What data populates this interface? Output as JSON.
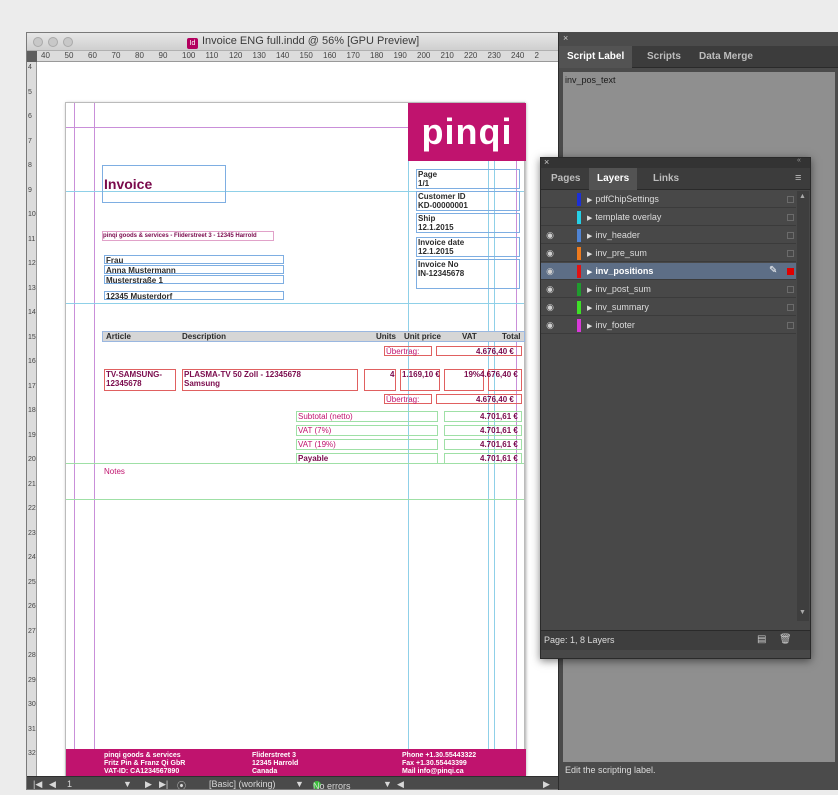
{
  "window": {
    "title": "Invoice ENG full.indd @ 56% [GPU Preview]"
  },
  "ruler": {
    "h_marks": [
      "40",
      "50",
      "60",
      "70",
      "80",
      "90",
      "100",
      "110",
      "120",
      "130",
      "140",
      "150",
      "160",
      "170",
      "180",
      "190",
      "200",
      "210",
      "220",
      "230",
      "240",
      "2"
    ],
    "v_marks": [
      "4",
      "5",
      "6",
      "7",
      "8",
      "9",
      "10",
      "11",
      "12",
      "13",
      "14",
      "15",
      "16",
      "17",
      "18",
      "19",
      "20",
      "21",
      "22",
      "23",
      "24",
      "25",
      "26",
      "27",
      "28",
      "29",
      "30",
      "31",
      "32"
    ]
  },
  "invoice": {
    "logo": "pinqi",
    "title": "Invoice",
    "sender_line": "pinqi goods & services - Fliderstreet 3 - 12345 Harrold",
    "recipient": [
      "Frau",
      "Anna Mustermann",
      "Musterstraße 1",
      "12345 Musterdorf"
    ],
    "meta": {
      "page_label": "Page",
      "page_value": "1/1",
      "customer_label": "Customer ID",
      "customer_value": "KD-00000001",
      "ship_label": "Ship",
      "ship_value": "12.1.2015",
      "date_label": "Invoice date",
      "date_value": "12.1.2015",
      "no_label": "Invoice No",
      "no_value": "IN-12345678"
    },
    "table_headers": {
      "article": "Article",
      "description": "Description",
      "units": "Units",
      "unit_price": "Unit price",
      "vat": "VAT",
      "total": "Total"
    },
    "carry_label": "Übertrag:",
    "carry_value": "4.676,40 €",
    "row": {
      "article": "TV-SAMSUNG-12345678",
      "description_1": "PLASMA-TV 50 Zoll - 12345678",
      "description_2": "Samsung",
      "units": "4",
      "unit_price": "1.169,10 €",
      "vat": "19%",
      "total": "4.676,40 €"
    },
    "carry2_label": "Übertrag:",
    "carry2_value": "4.676,40 €",
    "summary": [
      {
        "label": "Subtotal (netto)",
        "value": "4.701,61 €"
      },
      {
        "label": "VAT (7%)",
        "value": "4.701,61 €"
      },
      {
        "label": "VAT (19%)",
        "value": "4.701,61 €"
      },
      {
        "label": "Payable",
        "value": "4.701,61 €"
      }
    ],
    "notes": "Notes",
    "footer": {
      "c1": [
        "pinqi goods & services",
        "Fritz Pin & Franz Qi GbR",
        "VAT-ID: CA1234567890"
      ],
      "c2": [
        "Fliderstreet 3",
        "12345 Harrold",
        "Canada"
      ],
      "c3": [
        "Phone +1.30.55443322",
        "Fax +1.30.55443399",
        "Mail info@pinqi.ca"
      ]
    }
  },
  "statusbar": {
    "page": "1",
    "style": "[Basic] (working)",
    "errors": "No errors"
  },
  "script_panel": {
    "tabs": [
      "Script Label",
      "Scripts",
      "Data Merge"
    ],
    "label_text": "inv_pos_text",
    "hint": "Edit the scripting label."
  },
  "layers_panel": {
    "tabs": [
      "Pages",
      "Layers",
      "Links"
    ],
    "layers": [
      {
        "name": "pdfChipSettings",
        "color": "#1c2fd6",
        "visible": false
      },
      {
        "name": "template overlay",
        "color": "#25d0e6",
        "visible": false
      },
      {
        "name": "inv_header",
        "color": "#4f84d4",
        "visible": true
      },
      {
        "name": "inv_pre_sum",
        "color": "#ee7a1d",
        "visible": true
      },
      {
        "name": "inv_positions",
        "color": "#e01212",
        "visible": true,
        "selected": true
      },
      {
        "name": "inv_post_sum",
        "color": "#1f9b2e",
        "visible": true
      },
      {
        "name": "inv_summary",
        "color": "#3ee027",
        "visible": true
      },
      {
        "name": "inv_footer",
        "color": "#d938d9",
        "visible": true
      }
    ],
    "footer": "Page: 1, 8 Layers"
  },
  "colors": {
    "brand": "#c0136e",
    "panel_bg": "#484848"
  }
}
